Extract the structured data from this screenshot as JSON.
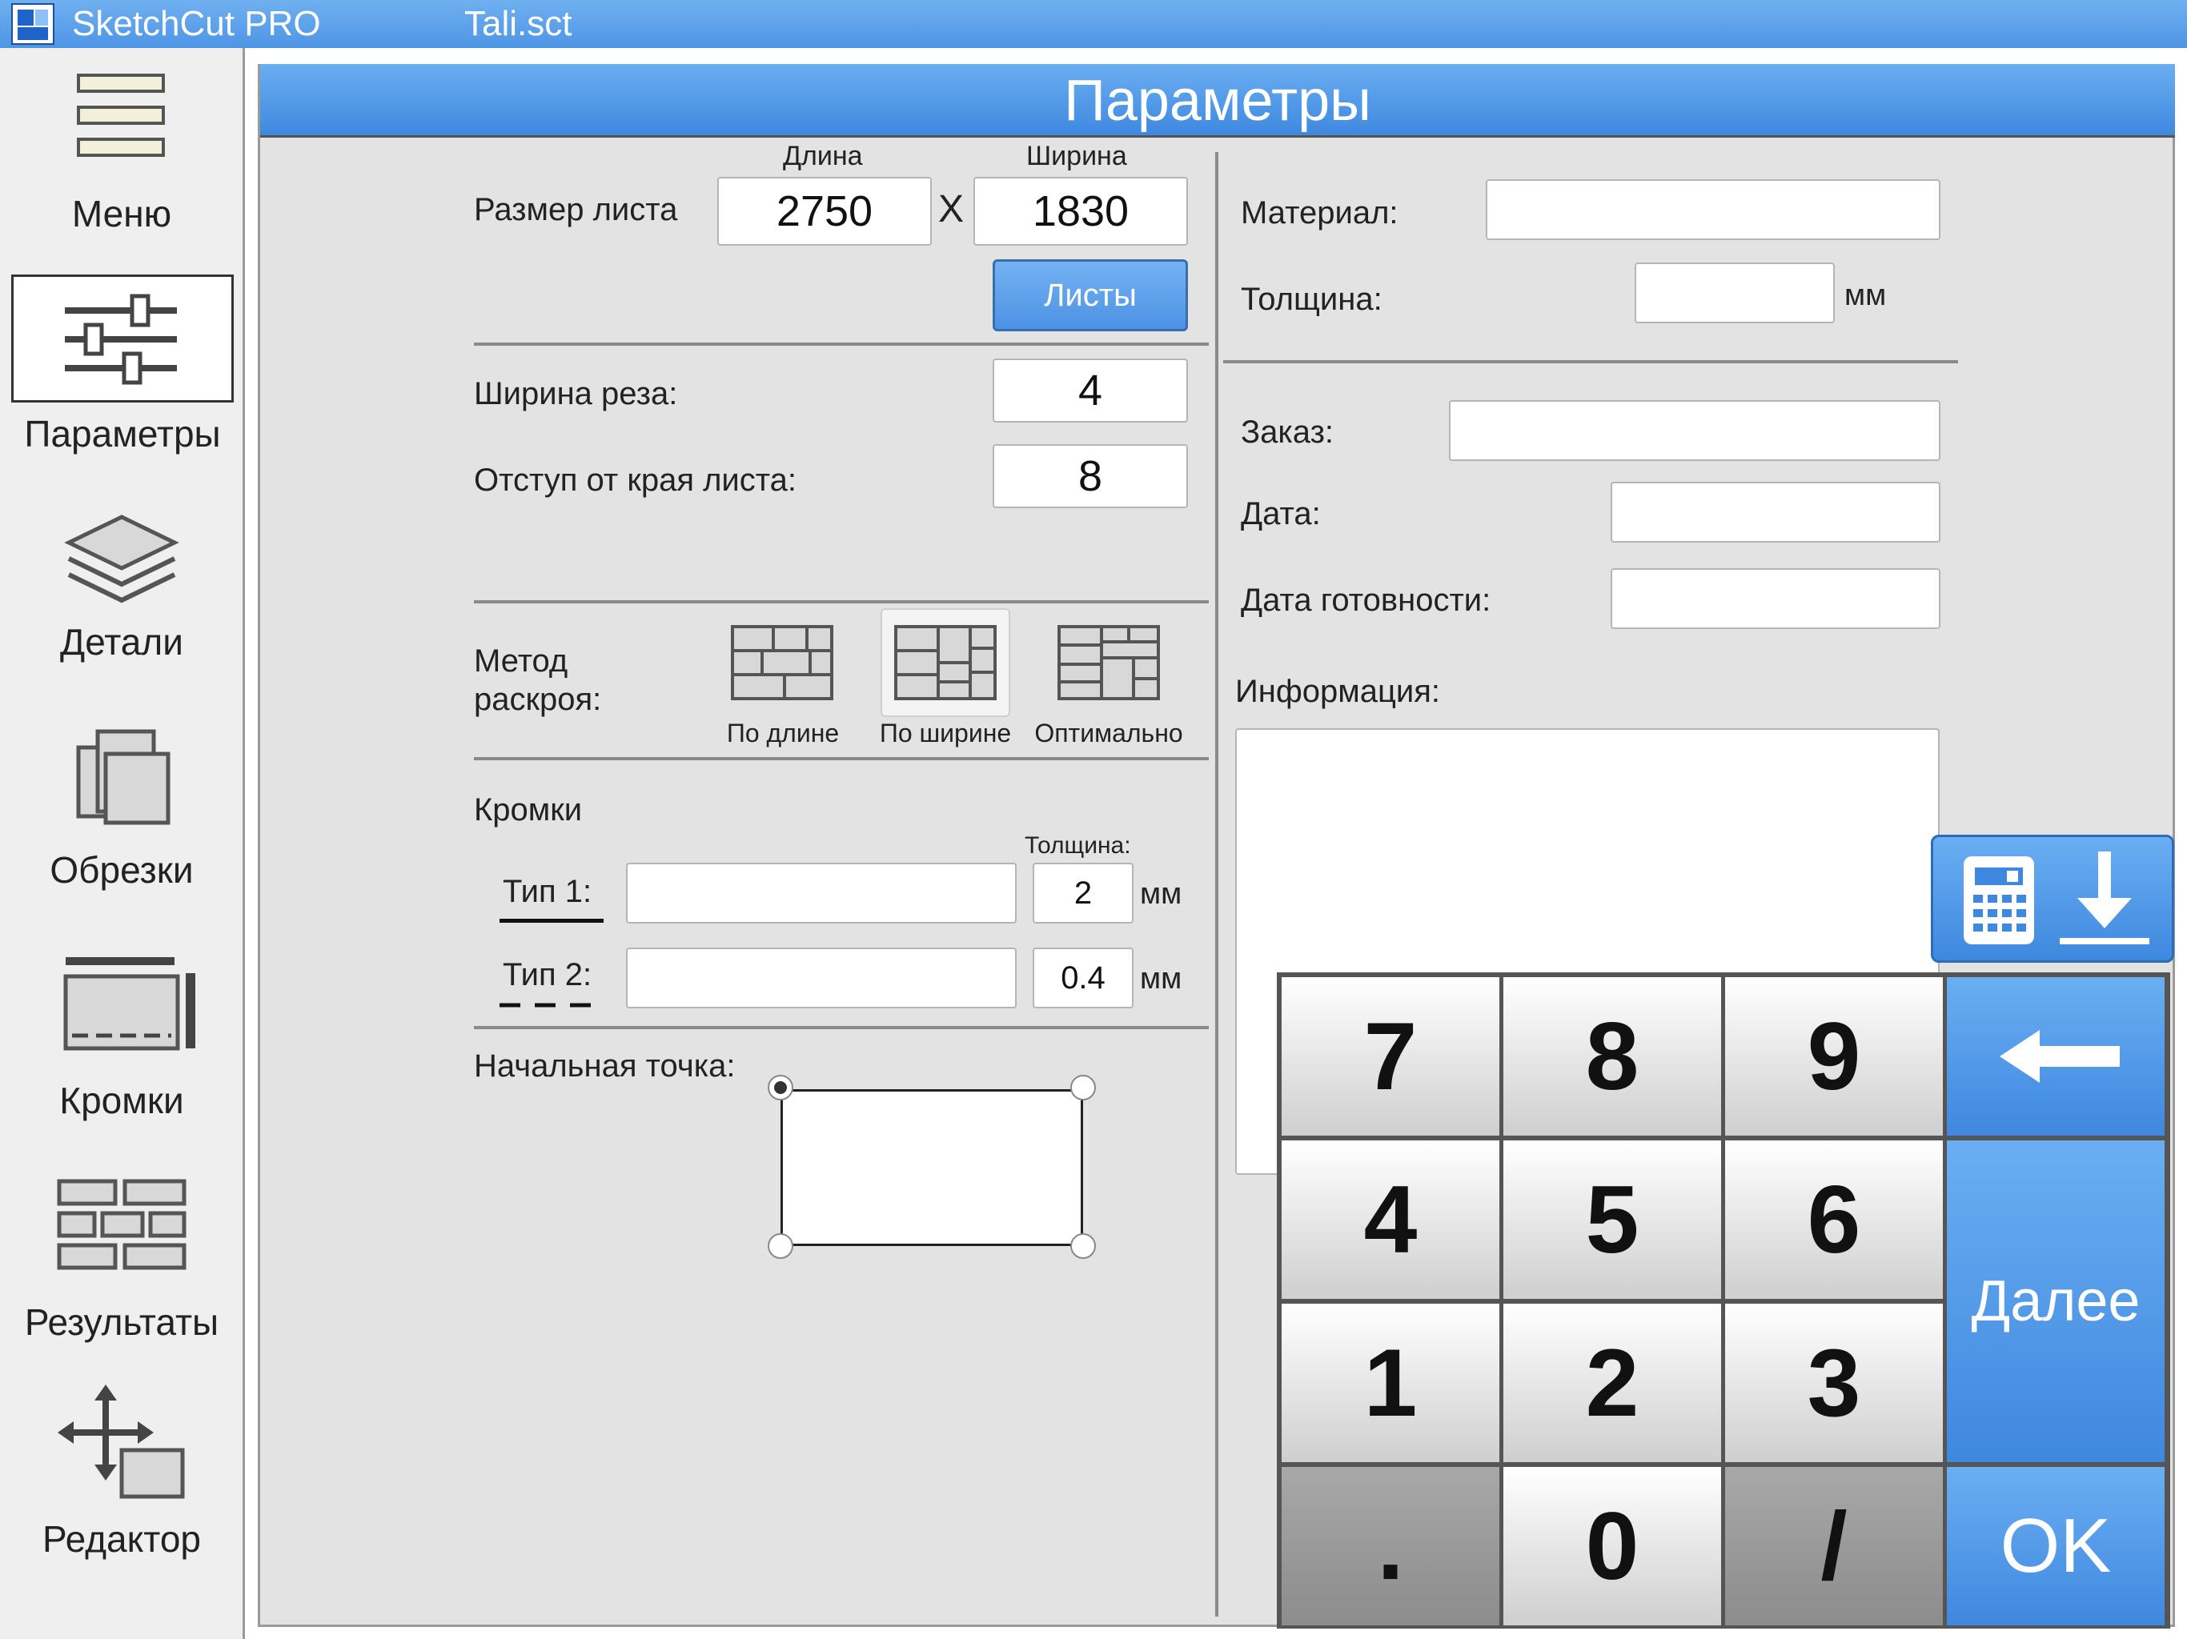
{
  "titlebar": {
    "app_name": "SketchCut PRO",
    "file_name": "Tali.sct"
  },
  "sidebar": {
    "items": [
      {
        "label": "Меню",
        "icon": "menu-icon"
      },
      {
        "label": "Параметры",
        "icon": "sliders-icon",
        "active": true
      },
      {
        "label": "Детали",
        "icon": "layers-icon"
      },
      {
        "label": "Обрезки",
        "icon": "scraps-icon"
      },
      {
        "label": "Кромки",
        "icon": "edges-icon"
      },
      {
        "label": "Результаты",
        "icon": "results-grid-icon"
      },
      {
        "label": "Редактор",
        "icon": "move-editor-icon"
      }
    ]
  },
  "panel": {
    "title": "Параметры"
  },
  "sheet": {
    "label": "Размер листа",
    "length_header": "Длина",
    "width_header": "Ширина",
    "length": "2750",
    "times": "X",
    "width": "1830",
    "sheets_button": "Листы"
  },
  "cut": {
    "kerf_label": "Ширина реза:",
    "kerf": "4",
    "margin_label": "Отступ от края листа:",
    "margin": "8"
  },
  "method": {
    "label_line1": "Метод",
    "label_line2": "раскроя:",
    "options": [
      {
        "label": "По длине",
        "icon": "cut-by-length-icon"
      },
      {
        "label": "По ширине",
        "icon": "cut-by-width-icon",
        "selected": true
      },
      {
        "label": "Оптимально",
        "icon": "cut-optimal-icon"
      }
    ]
  },
  "edges": {
    "title": "Кромки",
    "thickness_header": "Толщина:",
    "type1_label": "Тип 1:",
    "type1_value": "",
    "type1_thickness": "2",
    "type2_label": "Тип 2:",
    "type2_value": "",
    "type2_thickness": "0.4",
    "unit": "мм"
  },
  "start_point": {
    "label": "Начальная точка:"
  },
  "order_info": {
    "material_label": "Материал:",
    "material_value": "",
    "thickness_label": "Толщина:",
    "thickness_value": "",
    "thickness_unit": "мм",
    "order_label": "Заказ:",
    "order_value": "",
    "date_label": "Дата:",
    "date_value": "",
    "ready_date_label": "Дата готовности:",
    "ready_date_value": "",
    "info_label": "Информация:",
    "info_value": ""
  },
  "keypad": {
    "keys": [
      "7",
      "8",
      "9",
      "4",
      "5",
      "6",
      "1",
      "2",
      "3",
      ".",
      "0",
      "/"
    ],
    "backspace_icon": "arrow-left-icon",
    "next_label": "Далее",
    "ok_label": "OK",
    "calc_icon": "calculator-icon",
    "hide_icon": "arrow-down-icon"
  }
}
